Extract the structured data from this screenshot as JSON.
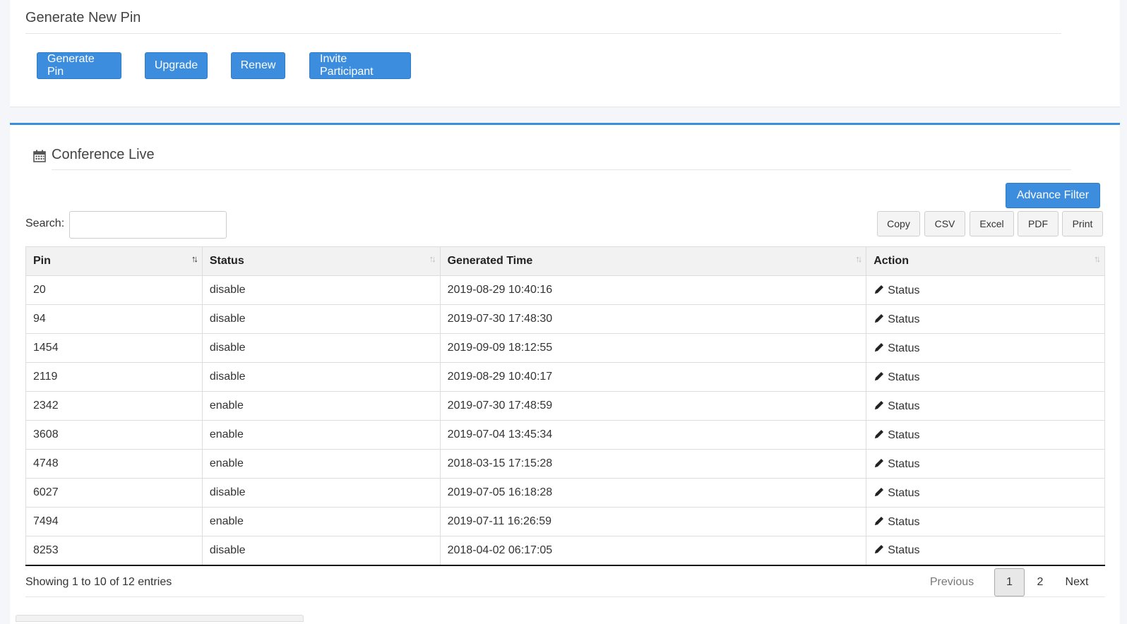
{
  "generate": {
    "title": "Generate New Pin",
    "buttons": {
      "generate_pin": "Generate Pin",
      "upgrade": "Upgrade",
      "renew": "Renew",
      "invite": "Invite Participant"
    }
  },
  "conference": {
    "title": "Conference Live",
    "advance_filter": "Advance Filter",
    "search_label": "Search:",
    "search_value": "",
    "export": {
      "copy": "Copy",
      "csv": "CSV",
      "excel": "Excel",
      "pdf": "PDF",
      "print": "Print"
    },
    "columns": [
      "Pin",
      "Status",
      "Generated Time",
      "Action"
    ],
    "rows": [
      {
        "pin": "20",
        "status": "disable",
        "time": "2019-08-29 10:40:16",
        "action": "Status"
      },
      {
        "pin": "94",
        "status": "disable",
        "time": "2019-07-30 17:48:30",
        "action": "Status"
      },
      {
        "pin": "1454",
        "status": "disable",
        "time": "2019-09-09 18:12:55",
        "action": "Status"
      },
      {
        "pin": "2119",
        "status": "disable",
        "time": "2019-08-29 10:40:17",
        "action": "Status"
      },
      {
        "pin": "2342",
        "status": "enable",
        "time": "2019-07-30 17:48:59",
        "action": "Status"
      },
      {
        "pin": "3608",
        "status": "enable",
        "time": "2019-07-04 13:45:34",
        "action": "Status"
      },
      {
        "pin": "4748",
        "status": "enable",
        "time": "2018-03-15 17:15:28",
        "action": "Status"
      },
      {
        "pin": "6027",
        "status": "disable",
        "time": "2019-07-05 16:18:28",
        "action": "Status"
      },
      {
        "pin": "7494",
        "status": "enable",
        "time": "2019-07-11 16:26:59",
        "action": "Status"
      },
      {
        "pin": "8253",
        "status": "disable",
        "time": "2018-04-02 06:17:05",
        "action": "Status"
      }
    ],
    "info": "Showing 1 to 10 of 12 entries",
    "pagination": {
      "previous": "Previous",
      "pages": [
        "1",
        "2"
      ],
      "next": "Next"
    }
  },
  "icons": {
    "title_icon": "calendar-icon",
    "action_icon": "pencil-icon",
    "sort_icon": "sort-arrows-icon"
  },
  "colors": {
    "primary": "#3c8dde",
    "accent_border": "#3c8dde"
  }
}
